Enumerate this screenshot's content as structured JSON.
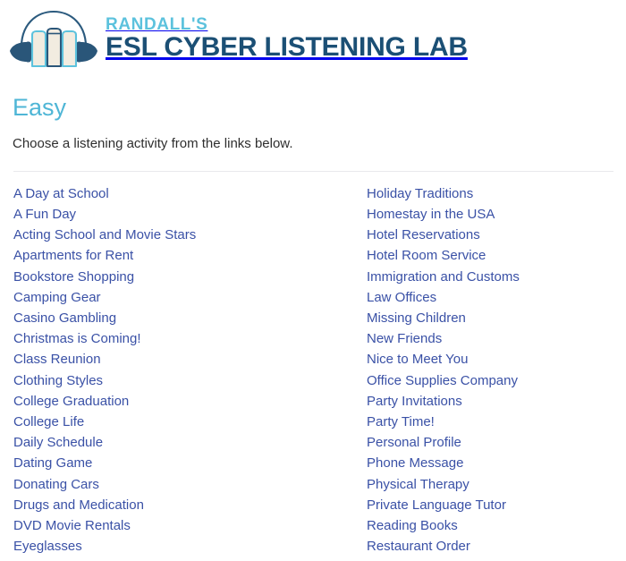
{
  "header": {
    "logo_icon": "headphones-over-books-icon",
    "brand_top": "RANDALL'S",
    "brand_main": "ESL CYBER LISTENING LAB",
    "brand_top_color": "#5cc2dd",
    "brand_main_color": "#1b4f75"
  },
  "main": {
    "title": "Easy",
    "title_color": "#4fb6d6",
    "intro": "Choose a listening activity from the links below.",
    "link_color": "#3a51a6",
    "divider_color": "#e9e9ec",
    "columns": [
      {
        "name": "left-column",
        "links": [
          "A Day at School",
          "A Fun Day",
          "Acting School and Movie Stars",
          "Apartments for Rent",
          "Bookstore Shopping",
          "Camping Gear",
          "Casino Gambling",
          "Christmas is Coming!",
          "Class Reunion",
          "Clothing Styles",
          "College Graduation",
          "College Life",
          "Daily Schedule",
          "Dating Game",
          "Donating Cars",
          "Drugs and Medication",
          "DVD Movie Rentals",
          "Eyeglasses"
        ]
      },
      {
        "name": "right-column",
        "links": [
          "Holiday Traditions",
          "Homestay in the USA",
          "Hotel Reservations",
          "Hotel Room Service",
          "Immigration and Customs",
          "Law Offices",
          "Missing Children",
          "New Friends",
          "Nice to Meet You",
          "Office Supplies Company",
          "Party Invitations",
          "Party Time!",
          "Personal Profile",
          "Phone Message",
          "Physical Therapy",
          "Private Language Tutor",
          "Reading Books",
          "Restaurant Order"
        ]
      }
    ]
  }
}
